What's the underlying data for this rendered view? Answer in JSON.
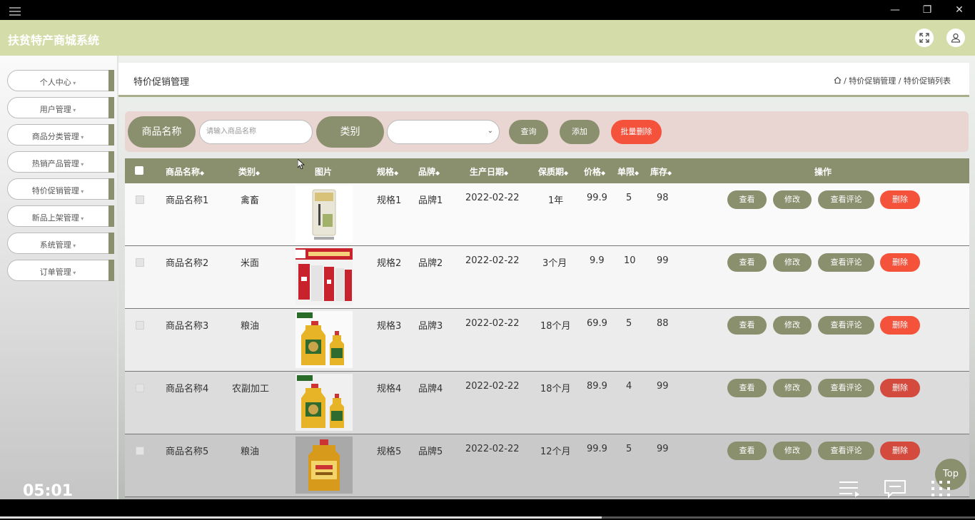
{
  "window": {
    "minimize_icon": "minimize-icon",
    "restore_icon": "restore-icon",
    "close_icon": "close-icon"
  },
  "app": {
    "title": "扶贫特产商城系统"
  },
  "sidebar": {
    "items": [
      {
        "label": "个人中心"
      },
      {
        "label": "用户管理"
      },
      {
        "label": "商品分类管理"
      },
      {
        "label": "热销产品管理"
      },
      {
        "label": "特价促销管理"
      },
      {
        "label": "新品上架管理"
      },
      {
        "label": "系统管理"
      },
      {
        "label": "订单管理"
      }
    ]
  },
  "page": {
    "title": "特价促销管理",
    "breadcrumb": " / 特价促销管理 / 特价促销列表"
  },
  "search": {
    "name_label": "商品名称",
    "name_placeholder": "请输入商品名称",
    "category_label": "类别",
    "query_label": "查询",
    "add_label": "添加",
    "batch_delete_label": "批量删除"
  },
  "table": {
    "columns": {
      "name": "商品名称",
      "category": "类别",
      "image": "图片",
      "spec": "规格",
      "brand": "品牌",
      "date": "生产日期",
      "shelf": "保质期",
      "price": "价格",
      "limit": "单限",
      "stock": "库存",
      "ops": "操作"
    },
    "sort_glyph": "◆",
    "actions": {
      "view": "查看",
      "edit": "修改",
      "comments": "查看评论",
      "delete": "删除"
    },
    "rows": [
      {
        "name": "商品名称1",
        "category": "禽畜",
        "spec": "规格1",
        "brand": "品牌1",
        "date": "2022-02-22",
        "shelf": "1年",
        "price": "99.9",
        "limit": "5",
        "stock": "98"
      },
      {
        "name": "商品名称2",
        "category": "米面",
        "spec": "规格2",
        "brand": "品牌2",
        "date": "2022-02-22",
        "shelf": "3个月",
        "price": "9.9",
        "limit": "10",
        "stock": "99"
      },
      {
        "name": "商品名称3",
        "category": "粮油",
        "spec": "规格3",
        "brand": "品牌3",
        "date": "2022-02-22",
        "shelf": "18个月",
        "price": "69.9",
        "limit": "5",
        "stock": "88"
      },
      {
        "name": "商品名称4",
        "category": "农副加工",
        "spec": "规格4",
        "brand": "品牌4",
        "date": "2022-02-22",
        "shelf": "18个月",
        "price": "89.9",
        "limit": "4",
        "stock": "99"
      },
      {
        "name": "商品名称5",
        "category": "粮油",
        "spec": "规格5",
        "brand": "品牌5",
        "date": "2022-02-22",
        "shelf": "12个月",
        "price": "99.9",
        "limit": "5",
        "stock": "99"
      }
    ]
  },
  "overlay": {
    "top_label": "Top",
    "timer": "05:01"
  },
  "colors": {
    "accent": "#8a8f6e",
    "header": "#d4ddaa",
    "danger": "#f4523b"
  }
}
